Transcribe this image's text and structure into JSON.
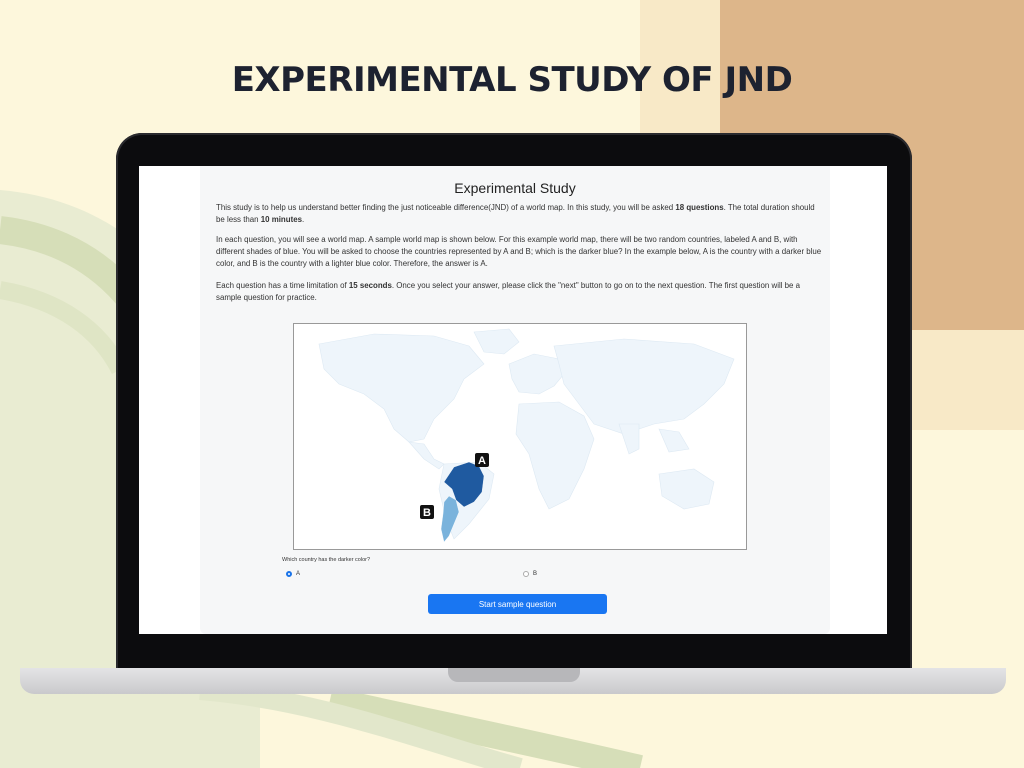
{
  "poster": {
    "title": "EXPERIMENTAL STUDY OF JND"
  },
  "study": {
    "title": "Experimental Study",
    "p1_a": "This study is to help us understand better finding the just noticeable difference(JND) of a world map. In this study, you will be asked ",
    "p1_b": "18 questions",
    "p1_c": ". The total duration should be less than ",
    "p1_d": "10 minutes",
    "p1_e": ".",
    "p2": "In each question, you will see a world map. A sample world map is shown below. For this example world map, there will be two random countries, labeled A and B, with different shades of blue. You will be asked to choose the countries represented by A and B; which is the darker blue? In the example below, A is the country with a darker blue color, and B is the country with a lighter blue color. Therefore, the answer is A.",
    "p3_a": "Each question has a time limitation of ",
    "p3_b": "15 seconds",
    "p3_c": ". Once you select your answer, please click the \"next\" button to go on to the next question. The first question will be a sample question for practice.",
    "map": {
      "label_a": "A",
      "label_b": "B",
      "color_a": "#1f5aa0",
      "color_b": "#7ab3dc",
      "land_color": "#eef5fb"
    },
    "question": "Which country has the darker color?",
    "options": [
      {
        "label": "A",
        "selected": true
      },
      {
        "label": "B",
        "selected": false
      }
    ],
    "start_button": "Start sample question"
  }
}
